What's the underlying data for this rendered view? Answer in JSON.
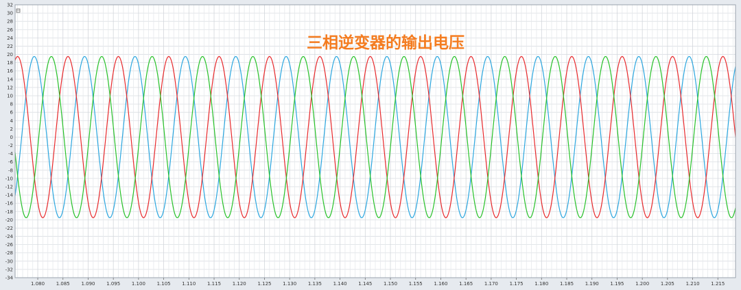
{
  "chart_data": {
    "type": "line",
    "title": "三相逆变器的输出电压",
    "title_color": "#f47c20",
    "xlim": [
      1.0755,
      1.2185
    ],
    "ylim": [
      -34,
      32
    ],
    "grid": true,
    "ytick_step": 2,
    "xtick_labels": [
      "1.080",
      "1.085",
      "1.090",
      "1.095",
      "1.100",
      "1.105",
      "1.110",
      "1.115",
      "1.120",
      "1.125",
      "1.130",
      "1.135",
      "1.140",
      "1.145",
      "1.150",
      "1.155",
      "1.160",
      "1.165",
      "1.170",
      "1.175",
      "1.180",
      "1.185",
      "1.190",
      "1.195",
      "1.200",
      "1.205",
      "1.210",
      "1.215"
    ],
    "xtick_values": [
      1.08,
      1.085,
      1.09,
      1.095,
      1.1,
      1.105,
      1.11,
      1.115,
      1.12,
      1.125,
      1.13,
      1.135,
      1.14,
      1.145,
      1.15,
      1.155,
      1.16,
      1.165,
      1.17,
      1.175,
      1.18,
      1.185,
      1.19,
      1.195,
      1.2,
      1.205,
      1.21,
      1.215
    ],
    "series": [
      {
        "color": "#2aa6df",
        "amplitude": 19.5,
        "period": 0.01,
        "first_peak_x": 1.0793
      },
      {
        "color": "#e8282b",
        "amplitude": 19.5,
        "period": 0.01,
        "first_peak_x": 1.086
      },
      {
        "color": "#26c128",
        "amplitude": 19.5,
        "period": 0.01,
        "first_peak_x": 1.0927
      }
    ]
  }
}
